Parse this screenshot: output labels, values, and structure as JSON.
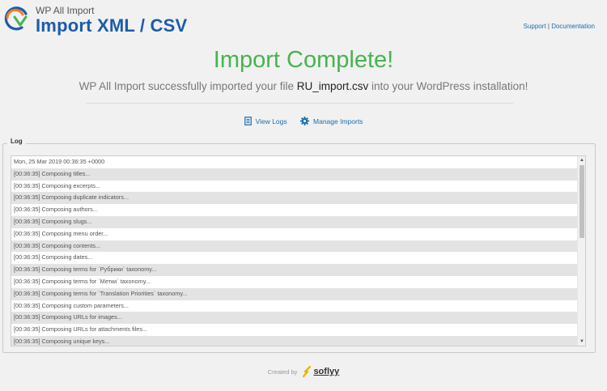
{
  "header": {
    "brand_small": "WP All Import",
    "brand_title": "Import XML / CSV",
    "support_label": "Support",
    "separator": "|",
    "documentation_label": "Documentation"
  },
  "complete": {
    "title": "Import Complete!",
    "message_prefix": "WP All Import successfully imported your file ",
    "file_name": "RU_import.csv",
    "message_suffix": " into your WordPress installation!"
  },
  "actions": {
    "view_logs": "View Logs",
    "manage_imports": "Manage Imports"
  },
  "log": {
    "legend": "Log",
    "lines": [
      "Mon, 25 Mar 2019 00:36:35 +0000",
      "[00:36:35] Composing titles...",
      "[00:36:35] Composing excerpts...",
      "[00:36:35] Composing duplicate indicators...",
      "[00:36:35] Composing authors...",
      "[00:36:35] Composing slugs...",
      "[00:36:35] Composing menu order...",
      "[00:36:35] Composing contents...",
      "[00:36:35] Composing dates...",
      "[00:36:35] Composing terms for `Рубрики` taxonomy...",
      "[00:36:35] Composing terms for `Метки` taxonomy...",
      "[00:36:35] Composing terms for `Translation Priorities` taxonomy...",
      "[00:36:35] Composing custom parameters...",
      "[00:36:35] Composing URLs for images...",
      "[00:36:35] Composing URLs for attachments files...",
      "[00:36:35] Composing unique keys..."
    ]
  },
  "footer": {
    "created_by": "Created by",
    "company": "soflyy"
  },
  "colors": {
    "brand_blue": "#1c5cab",
    "success_green": "#46b450",
    "link_blue": "#1b6dab",
    "logo_orange": "#f47b20"
  }
}
